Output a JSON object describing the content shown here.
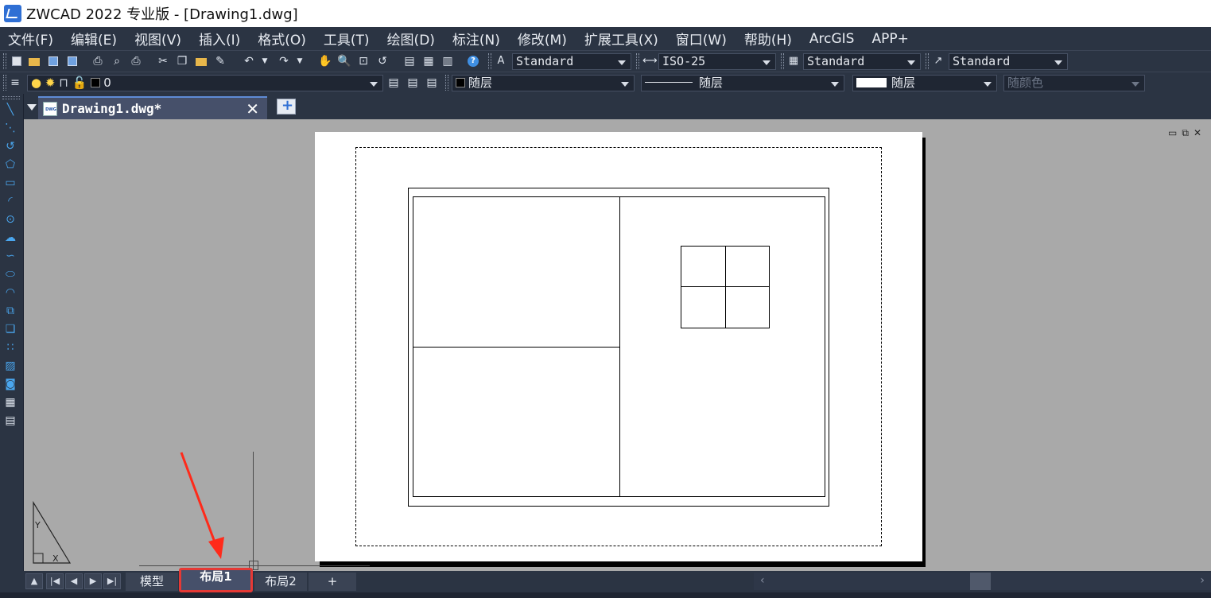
{
  "window": {
    "title": "ZWCAD 2022 专业版 - [Drawing1.dwg]"
  },
  "menu": [
    "文件(F)",
    "编辑(E)",
    "视图(V)",
    "插入(I)",
    "格式(O)",
    "工具(T)",
    "绘图(D)",
    "标注(N)",
    "修改(M)",
    "扩展工具(X)",
    "窗口(W)",
    "帮助(H)",
    "ArcGIS",
    "APP+"
  ],
  "toolbar1": {
    "text_style": "Standard",
    "dim_style": "ISO-25",
    "table_style": "Standard",
    "multileader_style": "Standard"
  },
  "toolbar2": {
    "layer": "0",
    "color": "随层",
    "linetype": "随层",
    "lineweight": "随层",
    "plot_style": "随颜色"
  },
  "doc_tab": {
    "title": "Drawing1.dwg*",
    "close": "✕"
  },
  "layout_tabs": {
    "model": "模型",
    "layout1": "布局1",
    "layout2": "布局2",
    "add": "+"
  },
  "colors": {
    "ui_dark": "#2b3443",
    "canvas_bg": "#a9a9a9",
    "paper": "#ffffff",
    "highlight": "#e53935",
    "icon_blue": "#4aa6ee"
  },
  "icons": {
    "left_toolbar": [
      "line-icon",
      "ray-icon",
      "polyline-icon",
      "polygon-icon",
      "rectangle-icon",
      "arc-icon",
      "circle-icon",
      "revcloud-icon",
      "spline-icon",
      "ellipse-icon",
      "ellipse-arc-icon",
      "insert-block-icon",
      "make-block-icon",
      "point-icon",
      "hatch-icon",
      "region-icon",
      "table-icon",
      "mtext-icon"
    ]
  }
}
